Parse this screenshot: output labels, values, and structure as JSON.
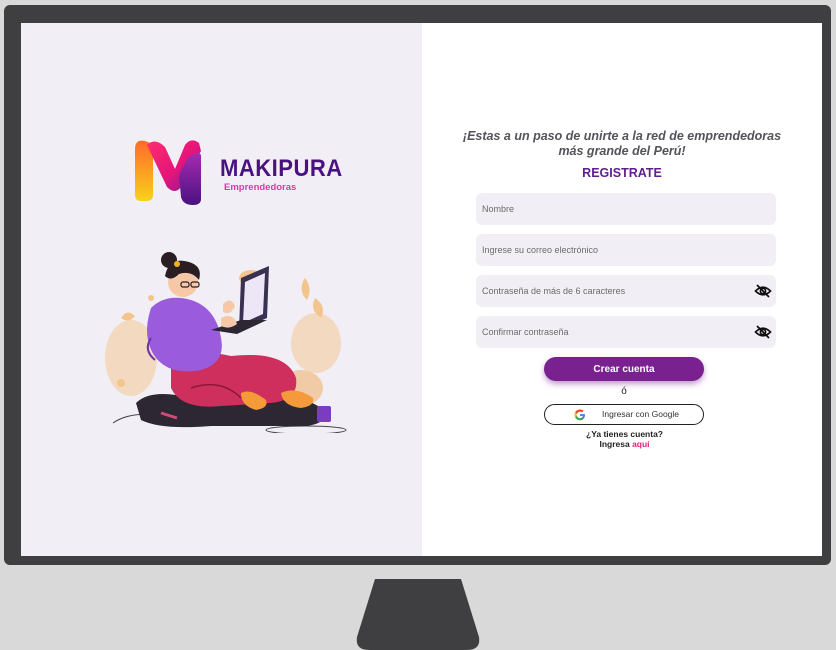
{
  "brand": {
    "name": "MAKIPURA",
    "subtitle": "Emprendedoras"
  },
  "register": {
    "tagline": "¡Estas a un paso de unirte a la red de emprendedoras más grande del Perú!",
    "title": "REGISTRATE",
    "fields": {
      "name": {
        "placeholder": "Nombre"
      },
      "email": {
        "placeholder": "Ingrese su correo electrónico"
      },
      "password": {
        "placeholder": "Contraseña de más de 6 caracteres"
      },
      "confirm": {
        "placeholder": "Confirmar contraseña"
      }
    },
    "create_button": "Crear cuenta",
    "or_text": "ó",
    "google_button": "Ingresar con Google",
    "have_account": "¿Ya tienes cuenta?",
    "login_prefix": "Ingresa ",
    "login_link": "aquí"
  },
  "colors": {
    "brand_purple": "#4a1281",
    "brand_pink": "#e534a6",
    "button_purple": "#7a2190",
    "link_pink": "#e0207c",
    "field_bg": "#f1eff5"
  },
  "icons": [
    "eye-off-icon",
    "google-icon",
    "makipura-logo-icon"
  ]
}
